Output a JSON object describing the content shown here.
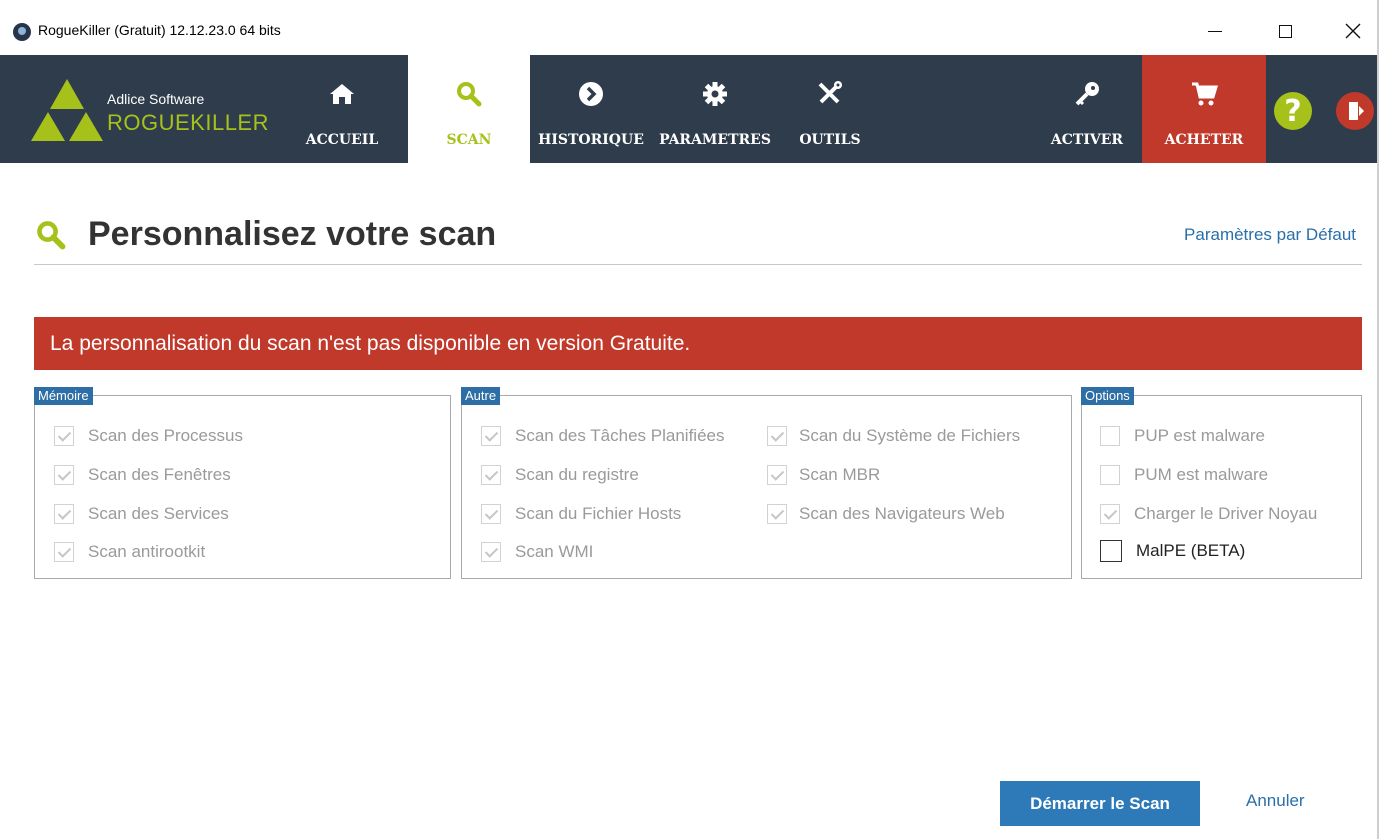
{
  "window": {
    "title": "RogueKiller (Gratuit) 12.12.23.0 64 bits"
  },
  "brand": {
    "company": "Adlice Software",
    "product": "ROGUEKILLER"
  },
  "nav": {
    "tabs": [
      {
        "label": "ACCUEIL",
        "icon": "home-icon"
      },
      {
        "label": "SCAN",
        "icon": "search-icon"
      },
      {
        "label": "HISTORIQUE",
        "icon": "chevron-right-icon"
      },
      {
        "label": "PARAMETRES",
        "icon": "gear-icon"
      },
      {
        "label": "OUTILS",
        "icon": "tools-icon"
      },
      {
        "label": "ACTIVER",
        "icon": "key-icon"
      },
      {
        "label": "ACHETER",
        "icon": "cart-icon"
      }
    ],
    "help_glyph": "?"
  },
  "page": {
    "title": "Personnalisez votre scan",
    "defaults_link": "Paramètres par Défaut",
    "alert": "La personnalisation du scan n'est pas disponible en version Gratuite."
  },
  "groups": {
    "memoire": {
      "legend": "Mémoire",
      "items": [
        {
          "label": "Scan des Processus",
          "checked": true
        },
        {
          "label": "Scan des Fenêtres",
          "checked": true
        },
        {
          "label": "Scan des Services",
          "checked": true
        },
        {
          "label": "Scan antirootkit",
          "checked": true
        }
      ]
    },
    "autre": {
      "legend": "Autre",
      "items": [
        {
          "label": "Scan des Tâches Planifiées",
          "checked": true
        },
        {
          "label": "Scan du registre",
          "checked": true
        },
        {
          "label": "Scan du Fichier Hosts",
          "checked": true
        },
        {
          "label": "Scan WMI",
          "checked": true
        },
        {
          "label": "Scan du Système de Fichiers",
          "checked": true
        },
        {
          "label": "Scan MBR",
          "checked": true
        },
        {
          "label": "Scan des Navigateurs Web",
          "checked": true
        }
      ]
    },
    "options": {
      "legend": "Options",
      "items": [
        {
          "label": "PUP est malware",
          "checked": false
        },
        {
          "label": "PUM est malware",
          "checked": false
        },
        {
          "label": "Charger le Driver Noyau",
          "checked": true
        },
        {
          "label": "MalPE (BETA)",
          "checked": false
        }
      ]
    }
  },
  "actions": {
    "start": "Démarrer le Scan",
    "cancel": "Annuler"
  },
  "colors": {
    "nav_bg": "#2e3c4c",
    "accent_green": "#a6c21a",
    "alert_red": "#c0392b",
    "primary_blue": "#2e7ab8"
  }
}
